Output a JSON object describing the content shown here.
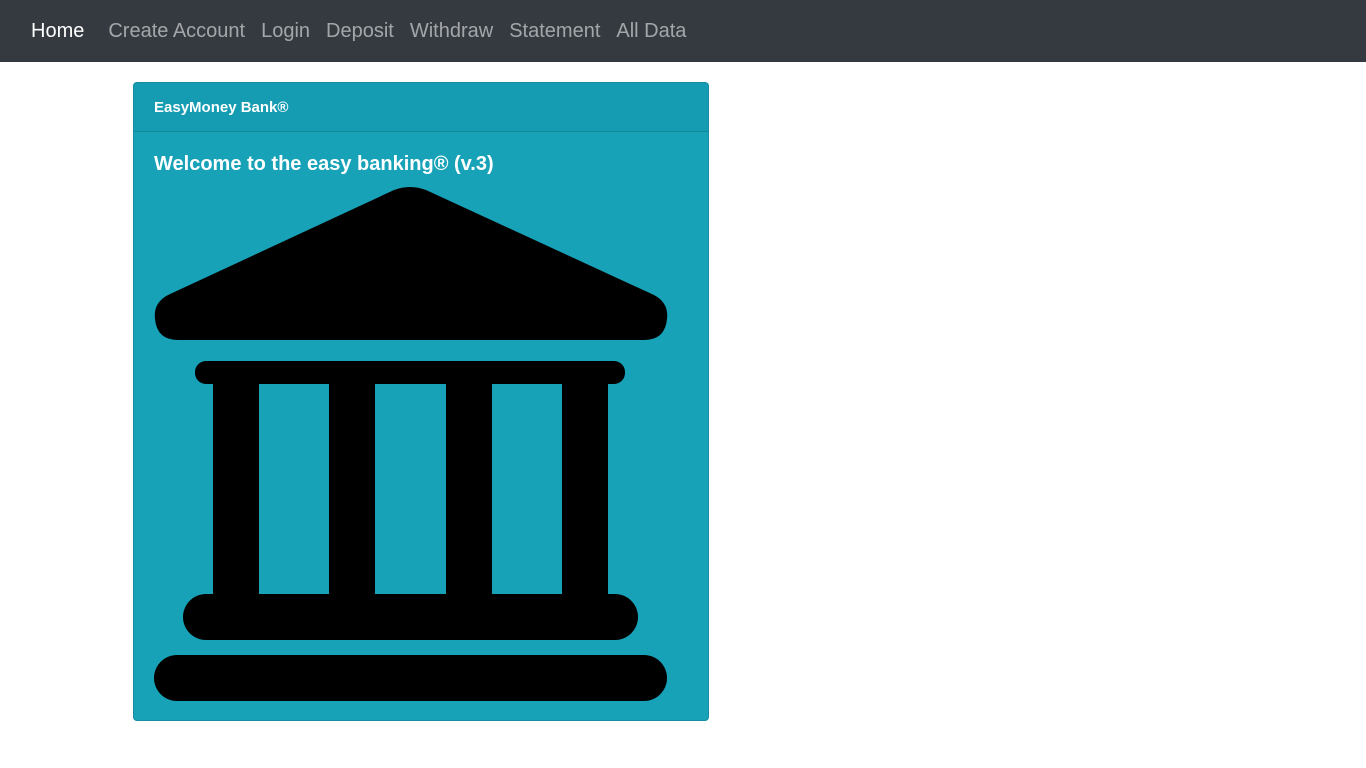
{
  "navbar": {
    "brand": "Home",
    "links": [
      "Create Account",
      "Login",
      "Deposit",
      "Withdraw",
      "Statement",
      "All Data"
    ]
  },
  "card": {
    "header": "EasyMoney Bank®",
    "title": "Welcome to the easy banking® (v.3)",
    "icon": "bank-icon",
    "background_color": "#17a2b8"
  }
}
